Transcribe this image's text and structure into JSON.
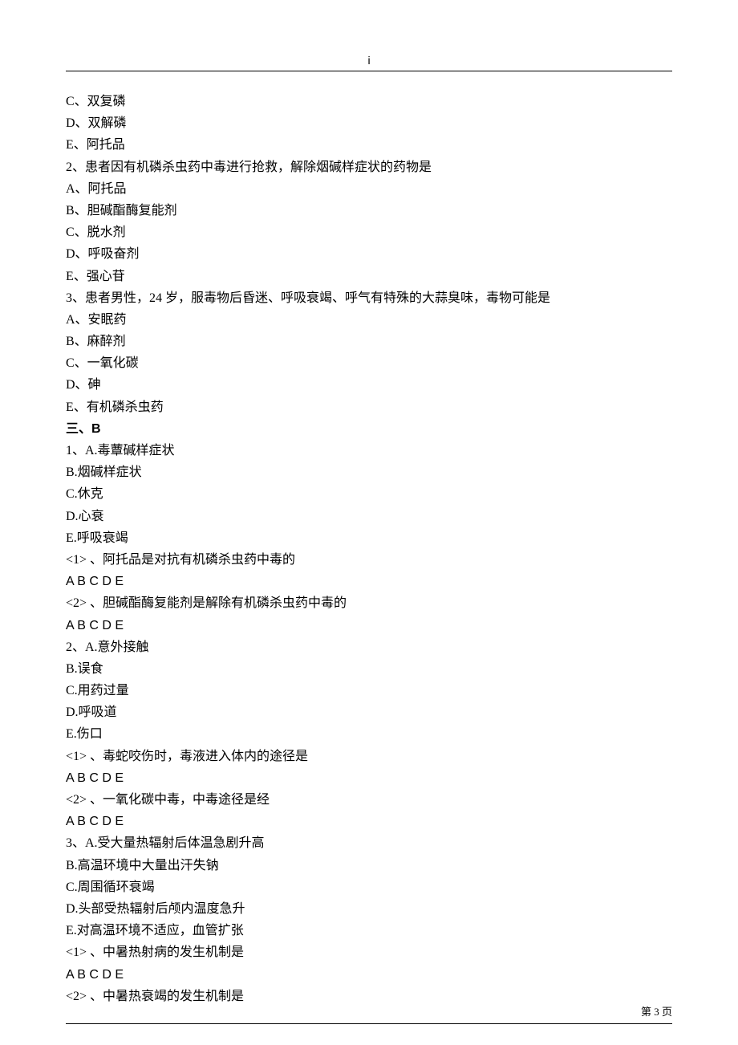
{
  "header": {
    "marker": "i"
  },
  "lines": [
    {
      "text": "C、双复磷"
    },
    {
      "text": "D、双解磷"
    },
    {
      "text": "E、阿托品"
    },
    {
      "text": "2、患者因有机磷杀虫药中毒进行抢救，解除烟碱样症状的药物是"
    },
    {
      "text": "A、阿托品"
    },
    {
      "text": "B、胆碱酯酶复能剂"
    },
    {
      "text": "C、脱水剂"
    },
    {
      "text": "D、呼吸奋剂"
    },
    {
      "text": "E、强心苷"
    },
    {
      "text": "3、患者男性，24 岁，服毒物后昏迷、呼吸衰竭、呼气有特殊的大蒜臭味，毒物可能是"
    },
    {
      "text": "A、安眠药"
    },
    {
      "text": "B、麻醉剂"
    },
    {
      "text": "C、一氧化碳"
    },
    {
      "text": "D、砷"
    },
    {
      "text": "E、有机磷杀虫药"
    },
    {
      "text": "三、B",
      "strong": true
    },
    {
      "text": "1、A.毒蕈碱样症状"
    },
    {
      "text": "B.烟碱样症状"
    },
    {
      "text": "C.休克"
    },
    {
      "text": "D.心衰"
    },
    {
      "text": "E.呼吸衰竭"
    },
    {
      "text": "<1> 、阿托品是对抗有机磷杀虫药中毒的"
    },
    {
      "text": "A B C D E",
      "latin": true
    },
    {
      "text": "<2> 、胆碱酯酶复能剂是解除有机磷杀虫药中毒的"
    },
    {
      "text": "A B C D E",
      "latin": true
    },
    {
      "text": "2、A.意外接触"
    },
    {
      "text": "B.误食"
    },
    {
      "text": "C.用药过量"
    },
    {
      "text": "D.呼吸道"
    },
    {
      "text": "E.伤口"
    },
    {
      "text": "<1> 、毒蛇咬伤时，毒液进入体内的途径是"
    },
    {
      "text": "A B C D E",
      "latin": true
    },
    {
      "text": "<2> 、一氧化碳中毒，中毒途径是经"
    },
    {
      "text": "A B C D E",
      "latin": true
    },
    {
      "text": "3、A.受大量热辐射后体温急剧升高"
    },
    {
      "text": "B.高温环境中大量出汗失钠"
    },
    {
      "text": "C.周围循环衰竭"
    },
    {
      "text": "D.头部受热辐射后颅内温度急升"
    },
    {
      "text": "E.对高温环境不适应，血管扩张"
    },
    {
      "text": "<1> 、中暑热射病的发生机制是"
    },
    {
      "text": "A B C D E",
      "latin": true
    },
    {
      "text": "<2> 、中暑热衰竭的发生机制是"
    }
  ],
  "footer": {
    "page_label": "第 3 页"
  }
}
